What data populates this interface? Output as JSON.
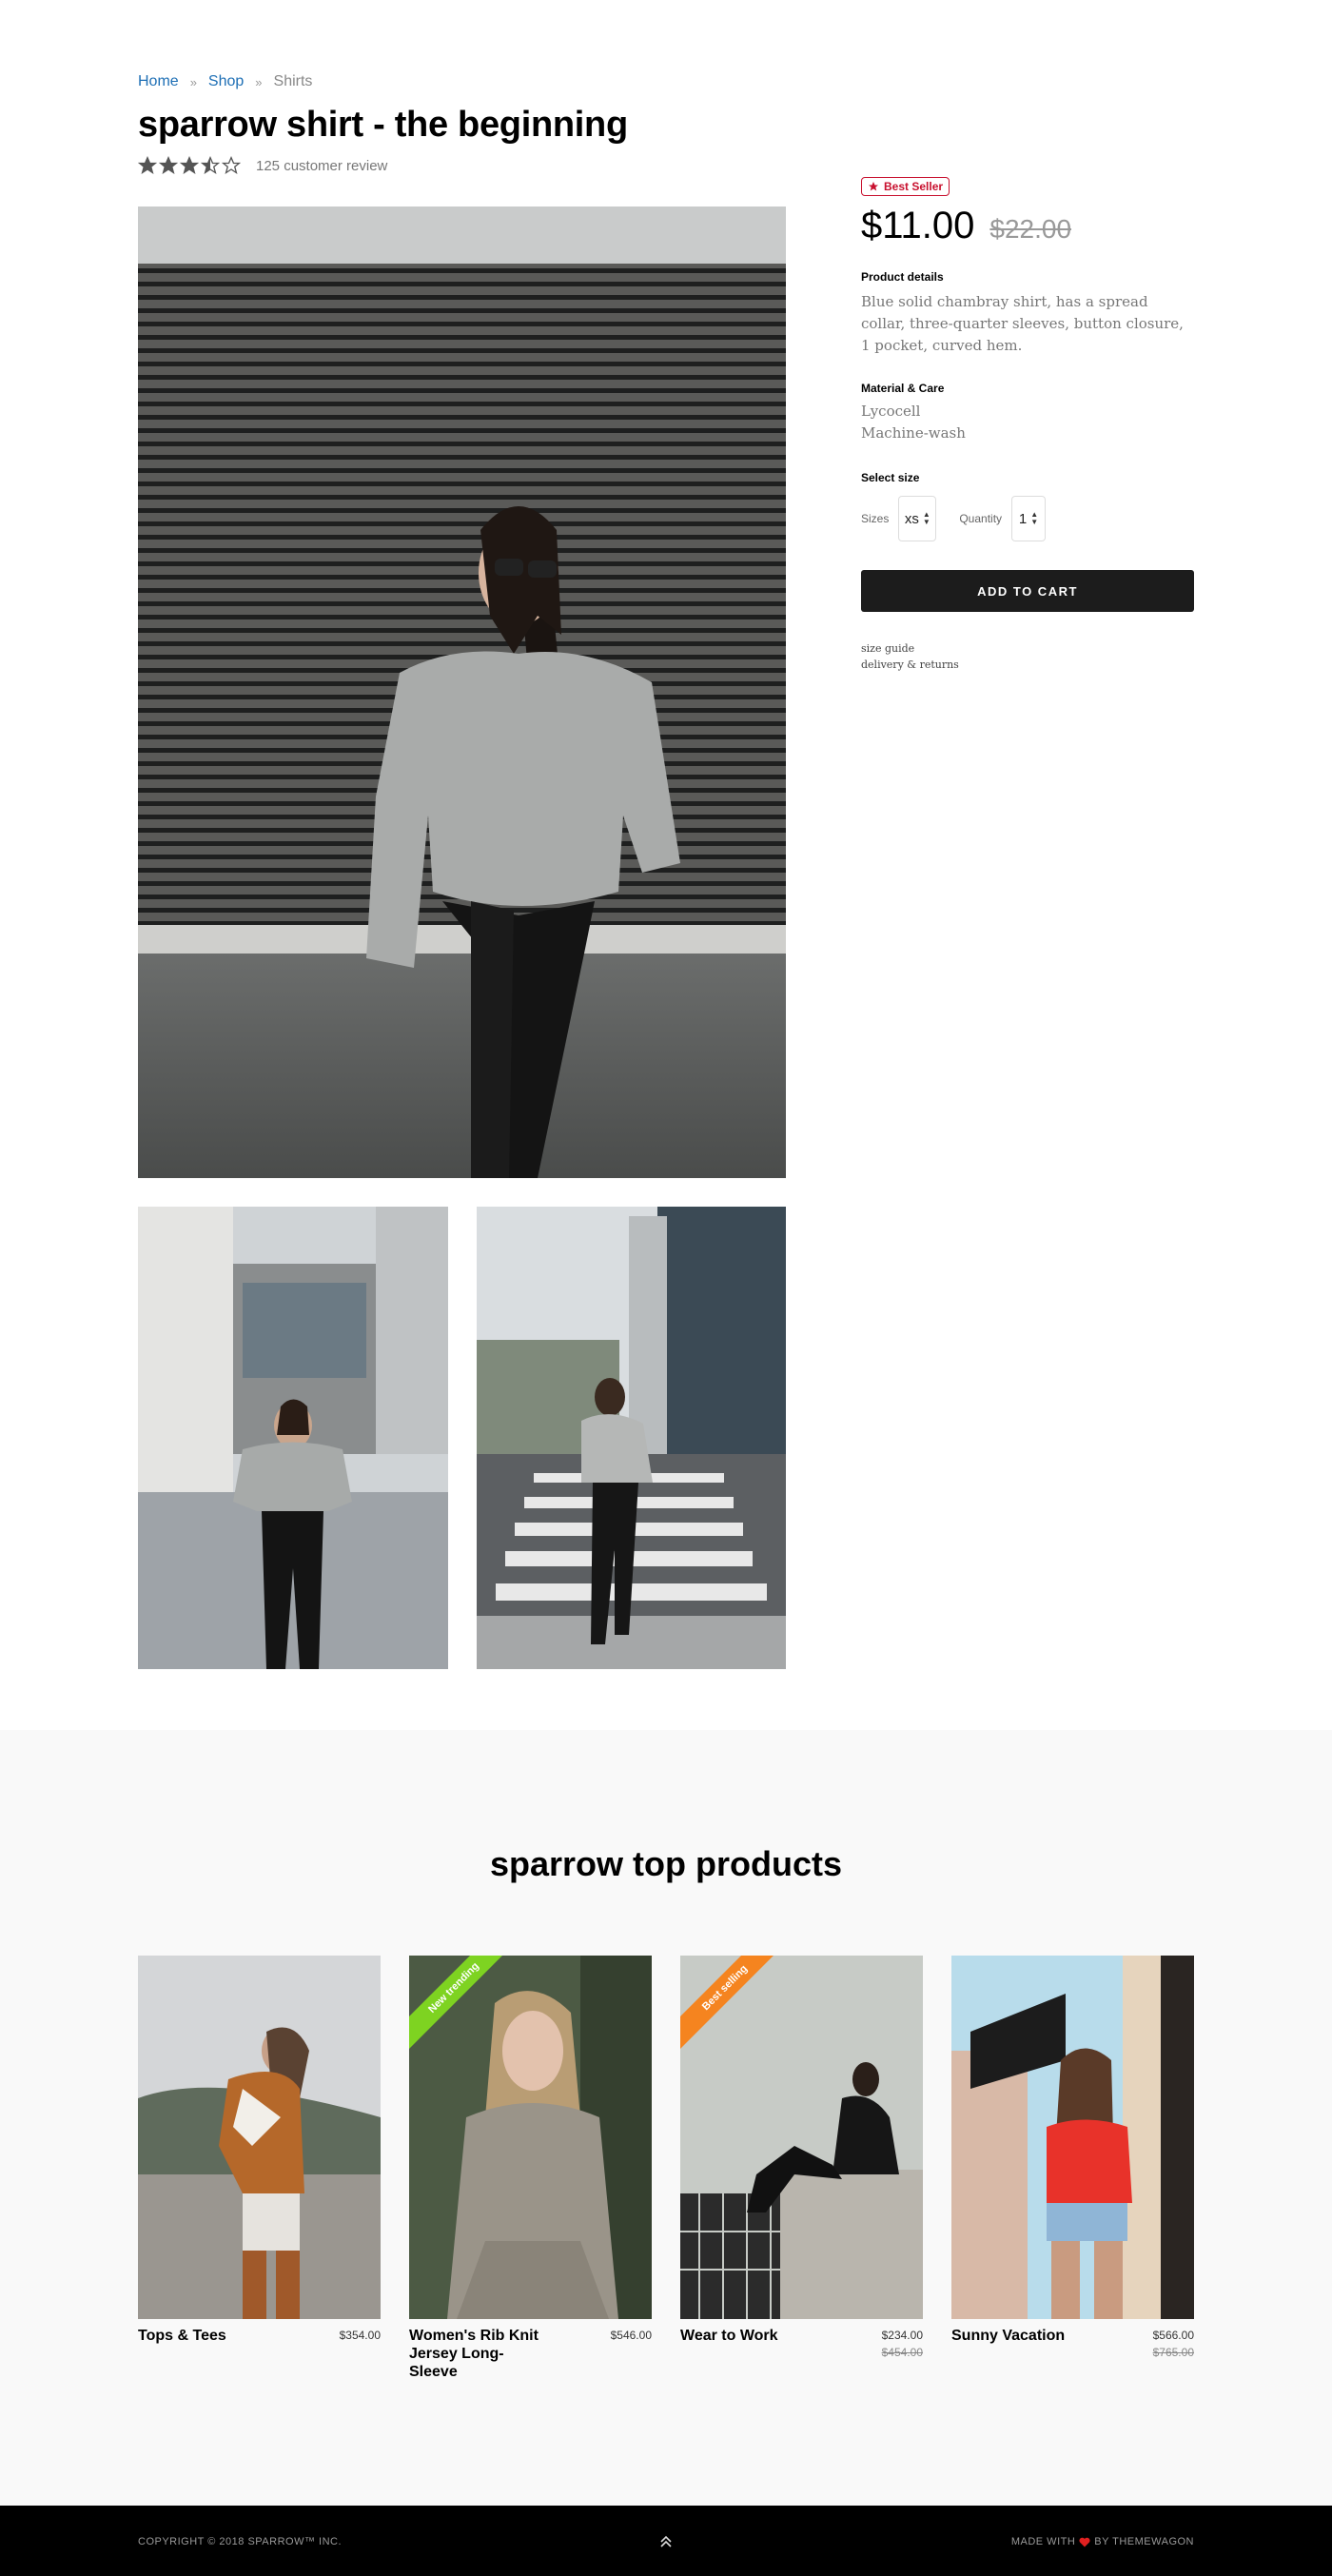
{
  "breadcrumb": {
    "home": "Home",
    "shop": "Shop",
    "current": "Shirts",
    "sep": "»"
  },
  "product": {
    "title": "sparrow shirt - the beginning",
    "rating": 3.5,
    "rating_max": 5,
    "review_text": "125 customer review",
    "badge": "Best Seller",
    "price": "$11.00",
    "old_price": "$22.00",
    "details_heading": "Product details",
    "details_text": "Blue solid chambray shirt, has a spread collar, three-quarter sleeves, button closure, 1 pocket, curved hem.",
    "material_heading": "Material & Care",
    "material_1": "Lycocell",
    "material_2": "Machine-wash",
    "size_heading": "Select size",
    "sizes_label": "Sizes",
    "size_value": "xs",
    "quantity_label": "Quantity",
    "quantity_value": "1",
    "add_to_cart": "ADD TO CART",
    "size_guide": "size guide",
    "delivery": "delivery & returns"
  },
  "top_products": {
    "title": "sparrow top products",
    "items": [
      {
        "name": "Tops & Tees",
        "price": "$354.00",
        "old_price": "",
        "ribbon": ""
      },
      {
        "name": "Women's Rib Knit Jersey Long-Sleeve",
        "price": "$546.00",
        "old_price": "",
        "ribbon": "New trending",
        "ribbon_color": "#7ed321"
      },
      {
        "name": "Wear to Work",
        "price": "$234.00",
        "old_price": "$454.00",
        "ribbon": "Best selling",
        "ribbon_color": "#f5841f"
      },
      {
        "name": "Sunny Vacation",
        "price": "$566.00",
        "old_price": "$765.00",
        "ribbon": ""
      }
    ]
  },
  "footer": {
    "copyright": "COPYRIGHT © 2018 SPARROW™ INC.",
    "made_prefix": "MADE WITH",
    "made_suffix": "BY THEMEWAGON"
  },
  "colors": {
    "link": "#1e6fb5",
    "badge": "#c8102e",
    "button": "#1c1c1c",
    "heart": "#e02020"
  },
  "icons": {
    "star": "star-icon",
    "badge": "star-icon",
    "scroll_top": "chevron-up-icon",
    "heart": "heart-icon"
  }
}
